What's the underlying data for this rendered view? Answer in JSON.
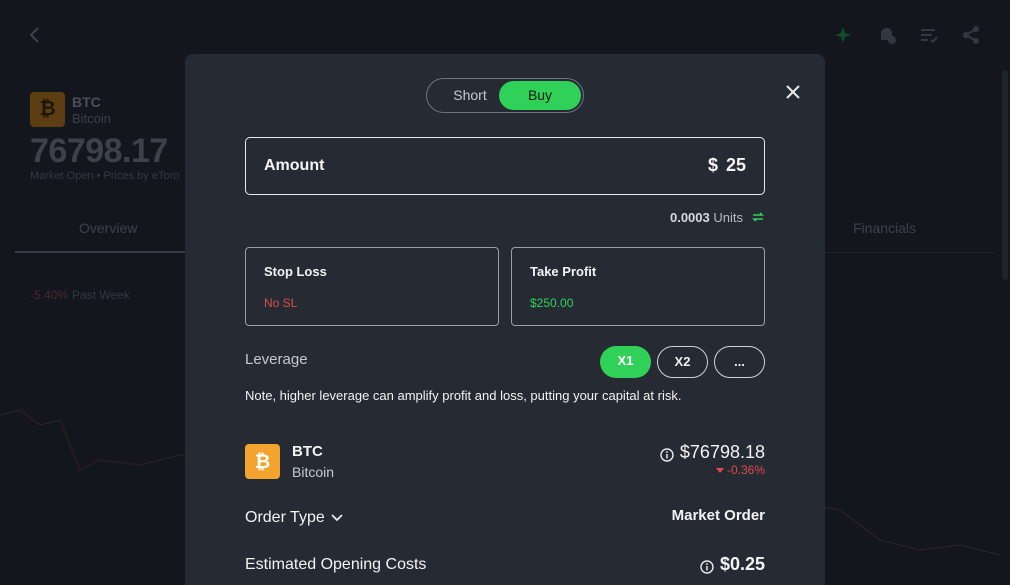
{
  "background": {
    "asset_symbol": "BTC",
    "asset_name": "Bitcoin",
    "price": "76798.17",
    "market_status": "Market Open • Prices by eToro",
    "tabs": [
      "Overview",
      "Financials"
    ],
    "change": "-5.40%",
    "change_period": "Past Week"
  },
  "modal": {
    "toggle": {
      "short_label": "Short",
      "buy_label": "Buy",
      "selected": "Buy"
    },
    "amount": {
      "label": "Amount",
      "currency": "$",
      "value": "25"
    },
    "units": {
      "value": "0.0003",
      "label": "Units"
    },
    "stop_loss": {
      "title": "Stop Loss",
      "value": "No SL"
    },
    "take_profit": {
      "title": "Take Profit",
      "value": "$250.00"
    },
    "leverage": {
      "label": "Leverage",
      "options": [
        "X1",
        "X2",
        "..."
      ],
      "selected": "X1",
      "note": "Note, higher leverage can amplify profit and loss, putting your capital at risk."
    },
    "instrument": {
      "symbol": "BTC",
      "name": "Bitcoin",
      "price": "$76798.18",
      "change": "-0.36%"
    },
    "order_type": {
      "label": "Order Type",
      "value": "Market Order"
    },
    "estimated_costs": {
      "label": "Estimated Opening Costs",
      "value": "$0.25"
    }
  },
  "colors": {
    "accent_green": "#2fd158",
    "negative_red": "#e04a4a",
    "modal_bg": "#262a33",
    "bitcoin_orange": "#f2a42f"
  }
}
